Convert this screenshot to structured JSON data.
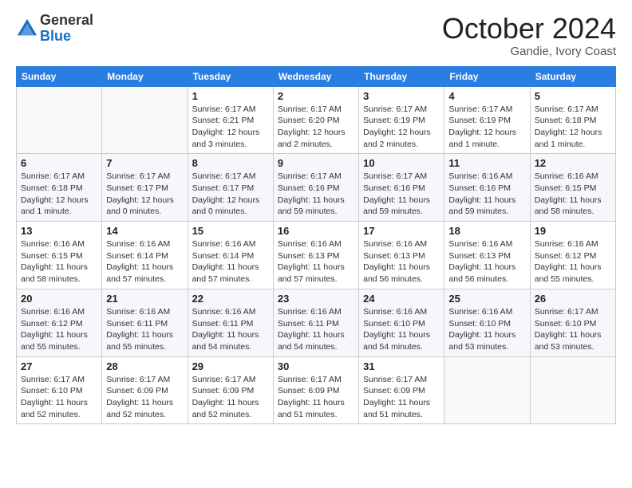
{
  "logo": {
    "general": "General",
    "blue": "Blue"
  },
  "header": {
    "month": "October 2024",
    "location": "Gandie, Ivory Coast"
  },
  "weekdays": [
    "Sunday",
    "Monday",
    "Tuesday",
    "Wednesday",
    "Thursday",
    "Friday",
    "Saturday"
  ],
  "weeks": [
    [
      {
        "day": "",
        "info": ""
      },
      {
        "day": "",
        "info": ""
      },
      {
        "day": "1",
        "info": "Sunrise: 6:17 AM\nSunset: 6:21 PM\nDaylight: 12 hours and 3 minutes."
      },
      {
        "day": "2",
        "info": "Sunrise: 6:17 AM\nSunset: 6:20 PM\nDaylight: 12 hours and 2 minutes."
      },
      {
        "day": "3",
        "info": "Sunrise: 6:17 AM\nSunset: 6:19 PM\nDaylight: 12 hours and 2 minutes."
      },
      {
        "day": "4",
        "info": "Sunrise: 6:17 AM\nSunset: 6:19 PM\nDaylight: 12 hours and 1 minute."
      },
      {
        "day": "5",
        "info": "Sunrise: 6:17 AM\nSunset: 6:18 PM\nDaylight: 12 hours and 1 minute."
      }
    ],
    [
      {
        "day": "6",
        "info": "Sunrise: 6:17 AM\nSunset: 6:18 PM\nDaylight: 12 hours and 1 minute."
      },
      {
        "day": "7",
        "info": "Sunrise: 6:17 AM\nSunset: 6:17 PM\nDaylight: 12 hours and 0 minutes."
      },
      {
        "day": "8",
        "info": "Sunrise: 6:17 AM\nSunset: 6:17 PM\nDaylight: 12 hours and 0 minutes."
      },
      {
        "day": "9",
        "info": "Sunrise: 6:17 AM\nSunset: 6:16 PM\nDaylight: 11 hours and 59 minutes."
      },
      {
        "day": "10",
        "info": "Sunrise: 6:17 AM\nSunset: 6:16 PM\nDaylight: 11 hours and 59 minutes."
      },
      {
        "day": "11",
        "info": "Sunrise: 6:16 AM\nSunset: 6:16 PM\nDaylight: 11 hours and 59 minutes."
      },
      {
        "day": "12",
        "info": "Sunrise: 6:16 AM\nSunset: 6:15 PM\nDaylight: 11 hours and 58 minutes."
      }
    ],
    [
      {
        "day": "13",
        "info": "Sunrise: 6:16 AM\nSunset: 6:15 PM\nDaylight: 11 hours and 58 minutes."
      },
      {
        "day": "14",
        "info": "Sunrise: 6:16 AM\nSunset: 6:14 PM\nDaylight: 11 hours and 57 minutes."
      },
      {
        "day": "15",
        "info": "Sunrise: 6:16 AM\nSunset: 6:14 PM\nDaylight: 11 hours and 57 minutes."
      },
      {
        "day": "16",
        "info": "Sunrise: 6:16 AM\nSunset: 6:13 PM\nDaylight: 11 hours and 57 minutes."
      },
      {
        "day": "17",
        "info": "Sunrise: 6:16 AM\nSunset: 6:13 PM\nDaylight: 11 hours and 56 minutes."
      },
      {
        "day": "18",
        "info": "Sunrise: 6:16 AM\nSunset: 6:13 PM\nDaylight: 11 hours and 56 minutes."
      },
      {
        "day": "19",
        "info": "Sunrise: 6:16 AM\nSunset: 6:12 PM\nDaylight: 11 hours and 55 minutes."
      }
    ],
    [
      {
        "day": "20",
        "info": "Sunrise: 6:16 AM\nSunset: 6:12 PM\nDaylight: 11 hours and 55 minutes."
      },
      {
        "day": "21",
        "info": "Sunrise: 6:16 AM\nSunset: 6:11 PM\nDaylight: 11 hours and 55 minutes."
      },
      {
        "day": "22",
        "info": "Sunrise: 6:16 AM\nSunset: 6:11 PM\nDaylight: 11 hours and 54 minutes."
      },
      {
        "day": "23",
        "info": "Sunrise: 6:16 AM\nSunset: 6:11 PM\nDaylight: 11 hours and 54 minutes."
      },
      {
        "day": "24",
        "info": "Sunrise: 6:16 AM\nSunset: 6:10 PM\nDaylight: 11 hours and 54 minutes."
      },
      {
        "day": "25",
        "info": "Sunrise: 6:16 AM\nSunset: 6:10 PM\nDaylight: 11 hours and 53 minutes."
      },
      {
        "day": "26",
        "info": "Sunrise: 6:17 AM\nSunset: 6:10 PM\nDaylight: 11 hours and 53 minutes."
      }
    ],
    [
      {
        "day": "27",
        "info": "Sunrise: 6:17 AM\nSunset: 6:10 PM\nDaylight: 11 hours and 52 minutes."
      },
      {
        "day": "28",
        "info": "Sunrise: 6:17 AM\nSunset: 6:09 PM\nDaylight: 11 hours and 52 minutes."
      },
      {
        "day": "29",
        "info": "Sunrise: 6:17 AM\nSunset: 6:09 PM\nDaylight: 11 hours and 52 minutes."
      },
      {
        "day": "30",
        "info": "Sunrise: 6:17 AM\nSunset: 6:09 PM\nDaylight: 11 hours and 51 minutes."
      },
      {
        "day": "31",
        "info": "Sunrise: 6:17 AM\nSunset: 6:09 PM\nDaylight: 11 hours and 51 minutes."
      },
      {
        "day": "",
        "info": ""
      },
      {
        "day": "",
        "info": ""
      }
    ]
  ]
}
